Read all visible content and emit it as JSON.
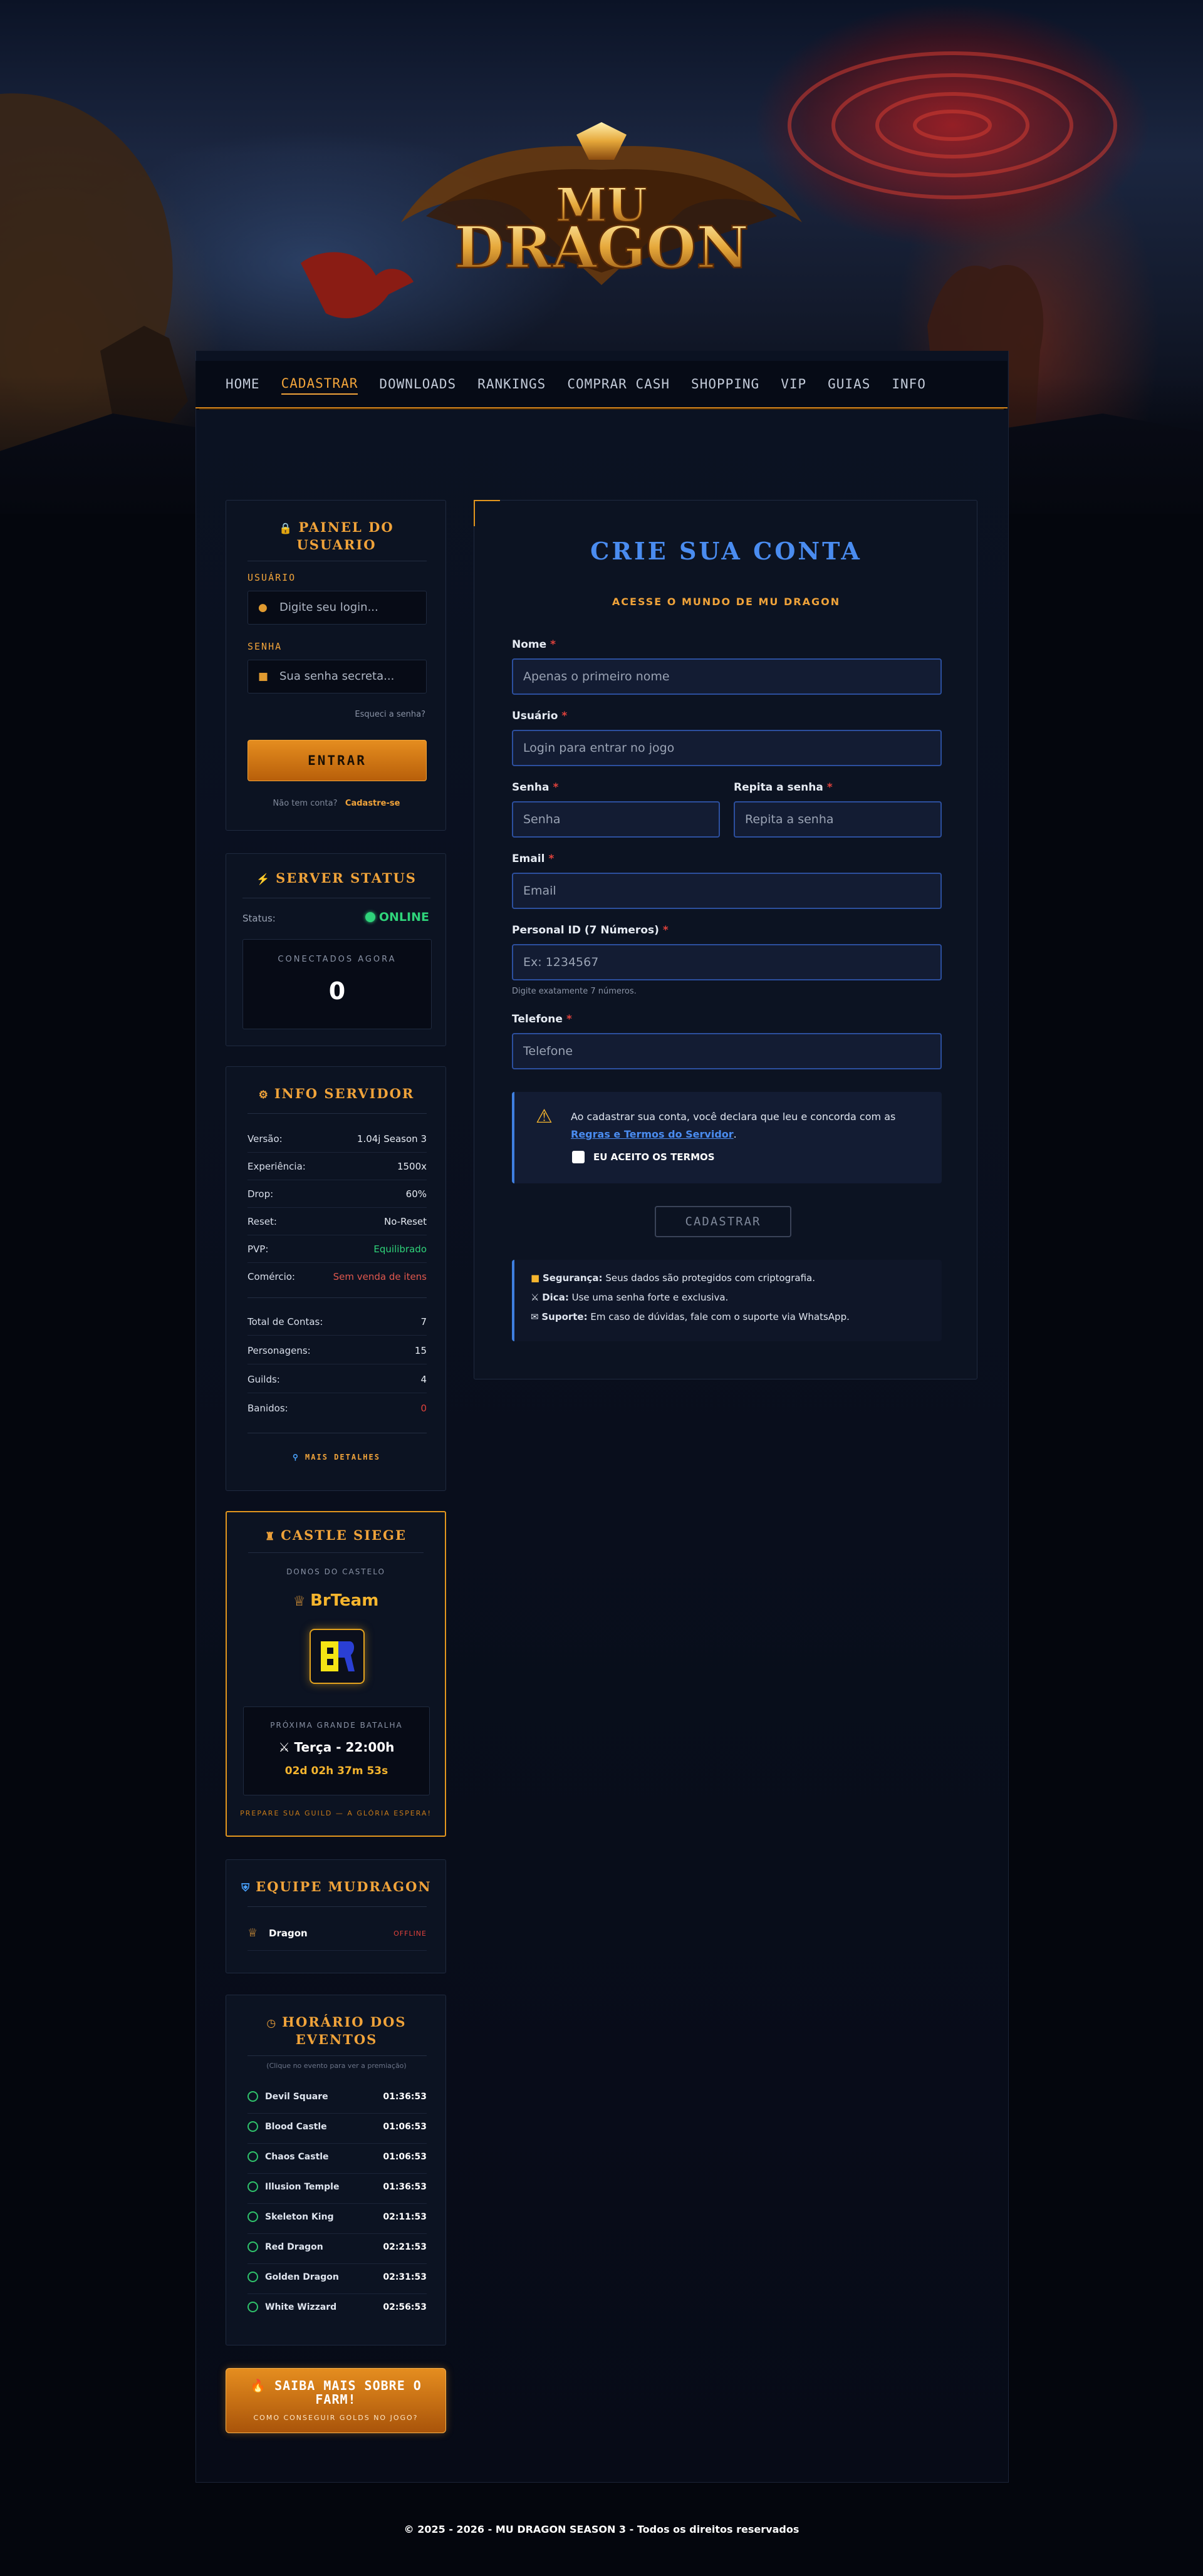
{
  "nav": {
    "items": [
      {
        "label": "HOME",
        "active": false
      },
      {
        "label": "CADASTRAR",
        "active": true
      },
      {
        "label": "DOWNLOADS",
        "active": false
      },
      {
        "label": "RANKINGS",
        "active": false
      },
      {
        "label": "COMPRAR CASH",
        "active": false
      },
      {
        "label": "SHOPPING",
        "active": false
      },
      {
        "label": "VIP",
        "active": false
      },
      {
        "label": "GUIAS",
        "active": false
      },
      {
        "label": "INFO",
        "active": false
      }
    ]
  },
  "logo": {
    "text_top": "MU",
    "text_main": "DRAGON"
  },
  "panel": {
    "title": "PAINEL DO USUARIO",
    "user_label": "USUÁRIO",
    "user_placeholder": "Digite seu login...",
    "pass_label": "SENHA",
    "pass_placeholder": "Sua senha secreta...",
    "forgot": "Esqueci a senha?",
    "login_button": "ENTRAR",
    "no_account": "Não tem conta?",
    "register_link": "Cadastre-se"
  },
  "server_status": {
    "title": "SERVER STATUS",
    "status_label": "Status:",
    "status_value": "ONLINE",
    "connected_label": "CONECTADOS AGORA",
    "connected_value": "0"
  },
  "info_servidor": {
    "title": "INFO SERVIDOR",
    "rows": [
      {
        "k": "Versão:",
        "v": "1.04j Season 3"
      },
      {
        "k": "Experiência:",
        "v": "1500x"
      },
      {
        "k": "Drop:",
        "v": "60%"
      },
      {
        "k": "Reset:",
        "v": "No-Reset"
      },
      {
        "k": "PVP:",
        "v": "Equilibrado"
      },
      {
        "k": "Comércio:",
        "v": "Sem venda de itens"
      }
    ],
    "stats": [
      {
        "k": "Total de Contas:",
        "v": "7"
      },
      {
        "k": "Personagens:",
        "v": "15"
      },
      {
        "k": "Guilds:",
        "v": "4"
      },
      {
        "k": "Banidos:",
        "v": "0"
      }
    ],
    "more_link": "MAIS DETALHES",
    "colors": {
      "pvp": "#2fd37a",
      "comercio": "#e0584e",
      "banidos": "#e0423c"
    }
  },
  "castle_siege": {
    "title": "CASTLE SIEGE",
    "owners_label": "DONOS DO CASTELO",
    "guild_name": "BrTeam",
    "next_label": "PRÓXIMA GRANDE BATALHA",
    "next_day": "Terça - 22:00h",
    "countdown": "02d 02h 37m 53s",
    "footer": "PREPARE SUA GUILD — A GLÓRIA ESPERA!"
  },
  "equipe": {
    "title": "EQUIPE MUDRAGON",
    "members": [
      {
        "name": "Dragon",
        "status": "OFFLINE"
      }
    ]
  },
  "eventos": {
    "title": "HORÁRIO DOS EVENTOS",
    "hint": "(Clique no evento para ver a premiação)",
    "items": [
      {
        "name": "Devil Square",
        "time": "01:36:53"
      },
      {
        "name": "Blood Castle",
        "time": "01:06:53"
      },
      {
        "name": "Chaos Castle",
        "time": "01:06:53"
      },
      {
        "name": "Illusion Temple",
        "time": "01:36:53"
      },
      {
        "name": "Skeleton King",
        "time": "02:11:53"
      },
      {
        "name": "Red Dragon",
        "time": "02:21:53"
      },
      {
        "name": "Golden Dragon",
        "time": "02:31:53"
      },
      {
        "name": "White Wizzard",
        "time": "02:56:53"
      }
    ]
  },
  "promo": {
    "title": "SAIBA MAIS SOBRE O FARM!",
    "subtitle": "COMO CONSEGUIR GOLDS NO JOGO?"
  },
  "form": {
    "title": "CRIE SUA CONTA",
    "subtitle": "ACESSE O MUNDO DE MU DRAGON",
    "nome_label": "Nome",
    "nome_placeholder": "Apenas o primeiro nome",
    "usuario_label": "Usuário",
    "usuario_placeholder": "Login para entrar no jogo",
    "senha_label": "Senha",
    "senha_placeholder": "Senha",
    "repita_label": "Repita a senha",
    "repita_placeholder": "Repita a senha",
    "email_label": "Email",
    "email_placeholder": "Email",
    "pid_label": "Personal ID (7 Números)",
    "pid_placeholder": "Ex: 1234567",
    "pid_hint": "Digite exatamente 7 números.",
    "tel_label": "Telefone",
    "tel_placeholder": "Telefone",
    "terms_text": "Ao cadastrar sua conta, você declara que leu e concorda com as",
    "terms_link": "Regras e Termos do Servidor",
    "terms_end": ".",
    "accept_label": "EU ACEITO OS TERMOS",
    "submit": "CADASTRAR",
    "tips": [
      {
        "strong": "Segurança:",
        "text": "Seus dados são protegidos com criptografia."
      },
      {
        "strong": "Dica:",
        "text": "Use uma senha forte e exclusiva."
      },
      {
        "strong": "Suporte:",
        "text": "Em caso de dúvidas, fale com o suporte via WhatsApp."
      }
    ]
  },
  "footer": {
    "text": "© 2025 - 2026 - MU DRAGON SEASON 3 - Todos os direitos reservados"
  },
  "icons": [
    "user-icon",
    "lock-icon",
    "warning-icon",
    "crown-icon",
    "swords-icon",
    "clock-icon",
    "gear-icon",
    "fire-icon"
  ]
}
